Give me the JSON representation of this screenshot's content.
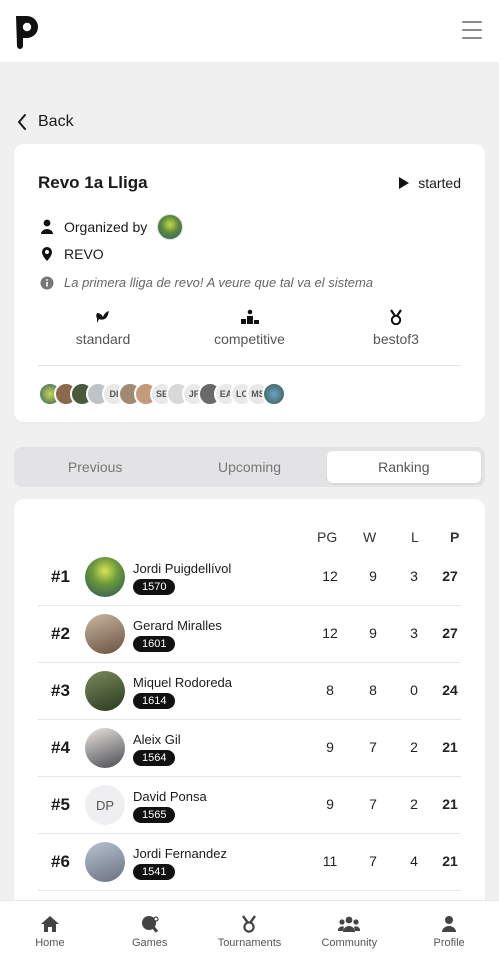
{
  "header": {
    "logo_letter": "P"
  },
  "back_label": "Back",
  "tournament": {
    "title": "Revo 1a Lliga",
    "status": "started",
    "organized_label": "Organized by",
    "location": "REVO",
    "description": "La primera lliga de revo! A veure que tal va el sistema",
    "modes": [
      "standard",
      "competitive",
      "bestof3"
    ],
    "participant_initials": [
      "DI",
      "SE",
      "JF",
      "EA",
      "LC",
      "MS"
    ]
  },
  "tabs": [
    "Previous",
    "Upcoming",
    "Ranking"
  ],
  "active_tab": "Ranking",
  "ranking": {
    "columns": [
      "PG",
      "W",
      "L",
      "P"
    ],
    "rows": [
      {
        "rank": "#1",
        "name": "Jordi Puigdellívol",
        "elo": "1570",
        "pg": "12",
        "w": "9",
        "l": "3",
        "p": "27",
        "initials": ""
      },
      {
        "rank": "#2",
        "name": "Gerard Miralles",
        "elo": "1601",
        "pg": "12",
        "w": "9",
        "l": "3",
        "p": "27",
        "initials": ""
      },
      {
        "rank": "#3",
        "name": "Miquel Rodoreda",
        "elo": "1614",
        "pg": "8",
        "w": "8",
        "l": "0",
        "p": "24",
        "initials": ""
      },
      {
        "rank": "#4",
        "name": "Aleix Gil",
        "elo": "1564",
        "pg": "9",
        "w": "7",
        "l": "2",
        "p": "21",
        "initials": ""
      },
      {
        "rank": "#5",
        "name": "David Ponsa",
        "elo": "1565",
        "pg": "9",
        "w": "7",
        "l": "2",
        "p": "21",
        "initials": "DP"
      },
      {
        "rank": "#6",
        "name": "Jordi Fernandez",
        "elo": "1541",
        "pg": "11",
        "w": "7",
        "l": "4",
        "p": "21",
        "initials": ""
      }
    ]
  },
  "bottom_nav": [
    "Home",
    "Games",
    "Tournaments",
    "Community",
    "Profile"
  ]
}
